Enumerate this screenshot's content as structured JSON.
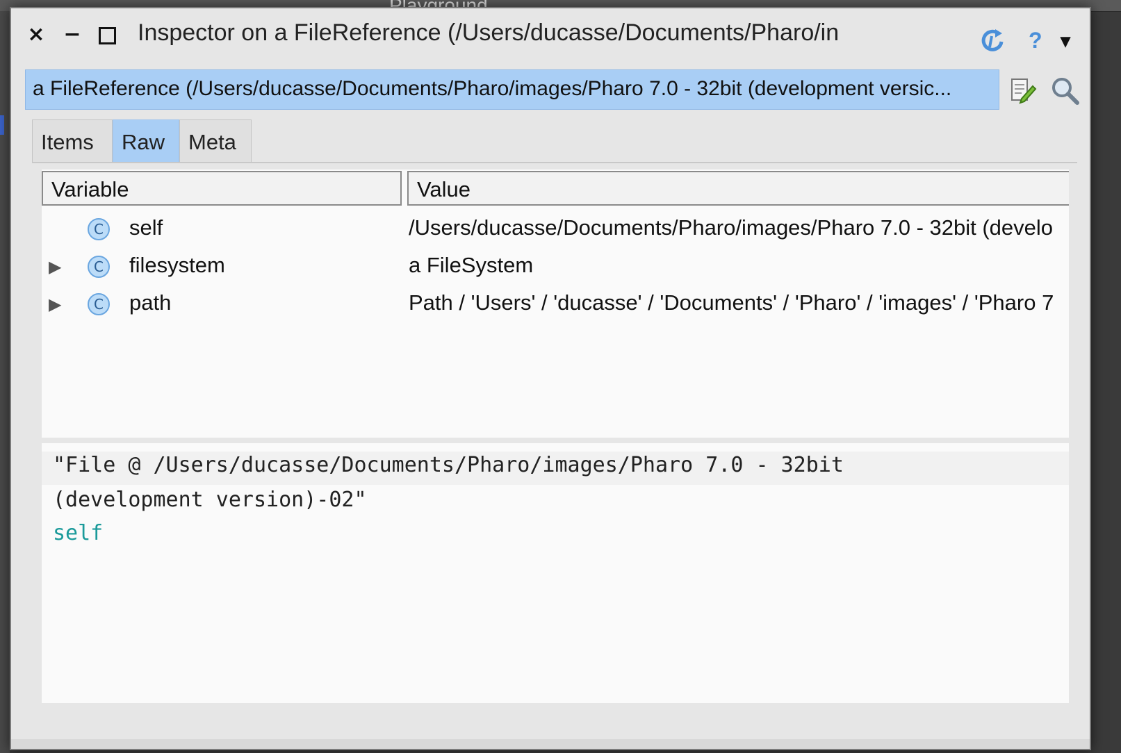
{
  "background": {
    "partial_title": "Playground"
  },
  "window": {
    "title": "Inspector on a FileReference (/Users/ducasse/Documents/Pharo/in",
    "controls": {
      "close": "×",
      "minimize": "−"
    },
    "right_icons": {
      "refresh": "↻",
      "help": "?",
      "menu": "▾"
    }
  },
  "inspect_bar": {
    "text": "a FileReference (/Users/ducasse/Documents/Pharo/images/Pharo 7.0 - 32bit (development versic..."
  },
  "tabs": [
    {
      "label": "Items",
      "active": false
    },
    {
      "label": "Raw",
      "active": true
    },
    {
      "label": "Meta",
      "active": false
    }
  ],
  "table": {
    "headers": {
      "variable": "Variable",
      "value": "Value"
    },
    "rows": [
      {
        "expandable": false,
        "icon": "C",
        "variable": "self",
        "value": "/Users/ducasse/Documents/Pharo/images/Pharo 7.0 - 32bit (develo"
      },
      {
        "expandable": true,
        "icon": "C",
        "variable": "filesystem",
        "value": "a FileSystem"
      },
      {
        "expandable": true,
        "icon": "C",
        "variable": "path",
        "value": "Path / 'Users' / 'ducasse' / 'Documents' / 'Pharo' / 'images' / 'Pharo 7"
      }
    ],
    "expander_glyph": "▶"
  },
  "code": {
    "line1": "\"File @ /Users/ducasse/Documents/Pharo/images/Pharo 7.0 - 32bit",
    "line2": "(development version)-02\"",
    "line3": "self"
  },
  "colors": {
    "selection": "#a9cef5",
    "keyword": "#1a9a9a",
    "accent_icon": "#4a8fd9"
  }
}
